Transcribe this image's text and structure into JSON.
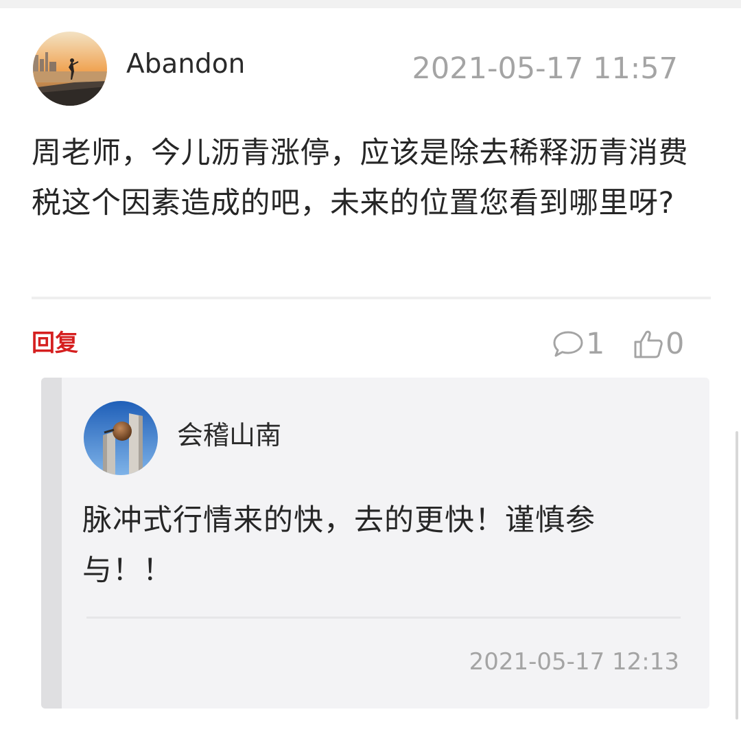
{
  "comment": {
    "username": "Abandon",
    "timestamp": "2021-05-17 11:57",
    "content": "周老师，今儿沥青涨停，应该是除去稀释沥青消费税这个因素造成的吧，未来的位置您看到哪里呀?",
    "reply_label": "回复",
    "comment_count": "1",
    "like_count": "0"
  },
  "reply": {
    "username": "会稽山南",
    "content": "脉冲式行情来的快，去的更快！谨慎参与！！",
    "timestamp": "2021-05-17 12:13"
  },
  "colors": {
    "reply_red": "#d51f1f",
    "meta_gray": "#a4a4a4",
    "reply_bg": "#f3f3f5"
  },
  "icons": {
    "comment": "speech-bubble-icon",
    "like": "thumbs-up-icon"
  }
}
